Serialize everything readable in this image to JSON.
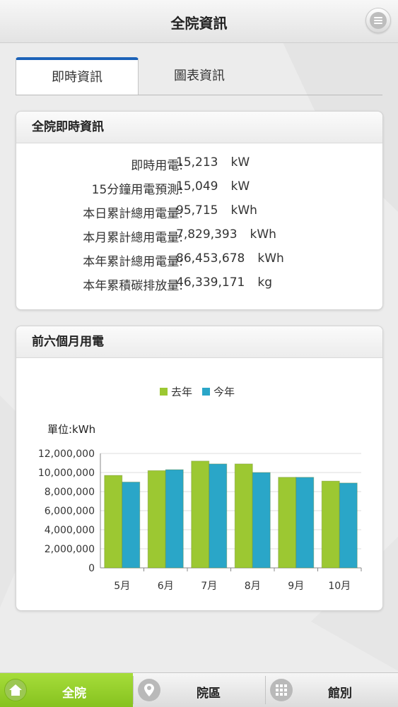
{
  "header": {
    "title": "全院資訊"
  },
  "tabs": [
    {
      "label": "即時資訊",
      "active": true
    },
    {
      "label": "圖表資訊",
      "active": false
    }
  ],
  "info_panel": {
    "title": "全院即時資訊",
    "rows": [
      {
        "label": "即時用電:",
        "value": "15,213",
        "unit": "kW"
      },
      {
        "label": "15分鐘用電預測:",
        "value": "15,049",
        "unit": "kW"
      },
      {
        "label": "本日累計總用電量:",
        "value": "95,715",
        "unit": "kWh"
      },
      {
        "label": "本月累計總用電量:",
        "value": "7,829,393",
        "unit": "kWh"
      },
      {
        "label": "本年累計總用電量:",
        "value": "86,453,678",
        "unit": "kWh"
      },
      {
        "label": "本年累積碳排放量:",
        "value": "46,339,171",
        "unit": "kg"
      }
    ]
  },
  "chart_panel": {
    "title": "前六個月用電"
  },
  "chart_data": {
    "type": "bar",
    "title": "",
    "unit_label": "單位:kWh",
    "xlabel": "",
    "ylabel": "",
    "categories": [
      "5月",
      "6月",
      "7月",
      "8月",
      "9月",
      "10月"
    ],
    "series": [
      {
        "name": "去年",
        "color": "#9cc832",
        "values": [
          9700000,
          10200000,
          11200000,
          10900000,
          9500000,
          9100000
        ]
      },
      {
        "name": "今年",
        "color": "#2aa6c8",
        "values": [
          9000000,
          10300000,
          10900000,
          10000000,
          9500000,
          8900000
        ]
      }
    ],
    "ylim": [
      0,
      12000000
    ],
    "yticks": [
      0,
      2000000,
      4000000,
      6000000,
      8000000,
      10000000,
      12000000
    ],
    "ytick_labels": [
      "0",
      "2,000,000",
      "4,000,000",
      "6,000,000",
      "8,000,000",
      "10,000,000",
      "12,000,000"
    ],
    "legend_position": "top",
    "grid": true
  },
  "bottom_nav": [
    {
      "label": "全院",
      "icon": "home-icon",
      "active": true
    },
    {
      "label": "院區",
      "icon": "location-pin-icon",
      "active": false
    },
    {
      "label": "館別",
      "icon": "grid-icon",
      "active": false
    }
  ],
  "colors": {
    "accent": "#1d63b8",
    "nav_active": "#8fc928"
  }
}
